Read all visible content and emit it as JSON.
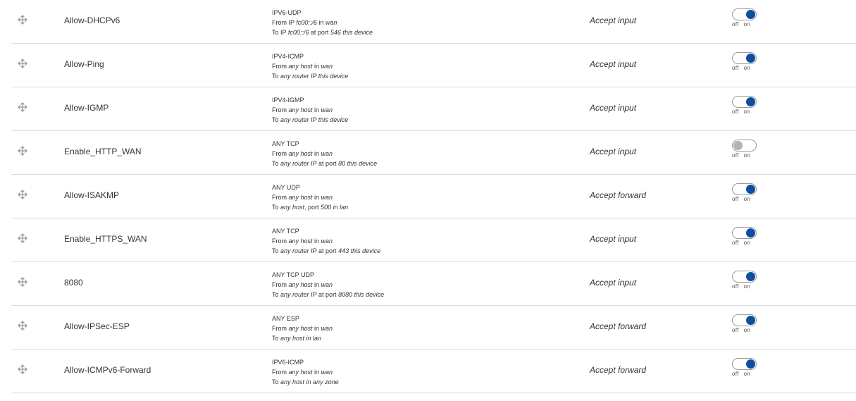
{
  "icons": {
    "drag": "drag-move-icon"
  },
  "colors": {
    "toggle_on": "#0d4f9e",
    "toggle_off": "#b3b3b3",
    "row_divider": "#dcdcdc"
  },
  "toggle_labels": {
    "off": "off",
    "on": "on"
  },
  "rules": [
    {
      "name": "Allow-DHCPv6",
      "proto": "IPV6-UDP",
      "from_prefix": "From IP ",
      "from_value": "fc00::/6",
      "from_mid": " in ",
      "from_zone": "wan",
      "to_prefix": "To IP ",
      "to_value": "fc00::/6",
      "to_mid": " at port ",
      "to_port": "546",
      "to_suffix": " this device",
      "action": "Accept input",
      "enabled": true
    },
    {
      "name": "Allow-Ping",
      "proto": "IPV4-ICMP",
      "from_prefix": "From ",
      "from_value": "any host",
      "from_mid": " in ",
      "from_zone": "wan",
      "to_prefix": "To ",
      "to_value": "any router IP",
      "to_mid": "",
      "to_port": "",
      "to_suffix": " this device",
      "action": "Accept input",
      "enabled": true
    },
    {
      "name": "Allow-IGMP",
      "proto": "IPV4-IGMP",
      "from_prefix": "From ",
      "from_value": "any host",
      "from_mid": " in ",
      "from_zone": "wan",
      "to_prefix": "To ",
      "to_value": "any router IP",
      "to_mid": "",
      "to_port": "",
      "to_suffix": " this device",
      "action": "Accept input",
      "enabled": true
    },
    {
      "name": "Enable_HTTP_WAN",
      "proto": "ANY TCP",
      "from_prefix": "From ",
      "from_value": "any host",
      "from_mid": " in ",
      "from_zone": "wan",
      "to_prefix": "To ",
      "to_value": "any router IP",
      "to_mid": " at port ",
      "to_port": "80",
      "to_suffix": " this device",
      "action": "Accept input",
      "enabled": false
    },
    {
      "name": "Allow-ISAKMP",
      "proto": "ANY UDP",
      "from_prefix": "From ",
      "from_value": "any host",
      "from_mid": " in ",
      "from_zone": "wan",
      "to_prefix": "To ",
      "to_value": "any host",
      "to_mid": ", port ",
      "to_port": "500",
      "to_suffix": " in lan",
      "action": "Accept forward",
      "enabled": true
    },
    {
      "name": "Enable_HTTPS_WAN",
      "proto": "ANY TCP",
      "from_prefix": "From ",
      "from_value": "any host",
      "from_mid": " in ",
      "from_zone": "wan",
      "to_prefix": "To ",
      "to_value": "any router IP",
      "to_mid": " at port ",
      "to_port": "443",
      "to_suffix": " this device",
      "action": "Accept input",
      "enabled": true
    },
    {
      "name": "8080",
      "proto": "ANY TCP UDP",
      "from_prefix": "From ",
      "from_value": "any host",
      "from_mid": " in ",
      "from_zone": "wan",
      "to_prefix": "To ",
      "to_value": "any router IP",
      "to_mid": " at port ",
      "to_port": "8080",
      "to_suffix": " this device",
      "action": "Accept input",
      "enabled": true
    },
    {
      "name": "Allow-IPSec-ESP",
      "proto": "ANY ESP",
      "from_prefix": "From ",
      "from_value": "any host",
      "from_mid": " in ",
      "from_zone": "wan",
      "to_prefix": "To ",
      "to_value": "any host",
      "to_mid": "",
      "to_port": "",
      "to_suffix": " in lan",
      "action": "Accept forward",
      "enabled": true
    },
    {
      "name": "Allow-ICMPv6-Forward",
      "proto": "IPV6-ICMP",
      "from_prefix": "From ",
      "from_value": "any host",
      "from_mid": " in ",
      "from_zone": "wan",
      "to_prefix": "To ",
      "to_value": "any host",
      "to_mid": "",
      "to_port": "",
      "to_suffix": " in any zone",
      "action": "Accept forward",
      "enabled": true
    }
  ]
}
